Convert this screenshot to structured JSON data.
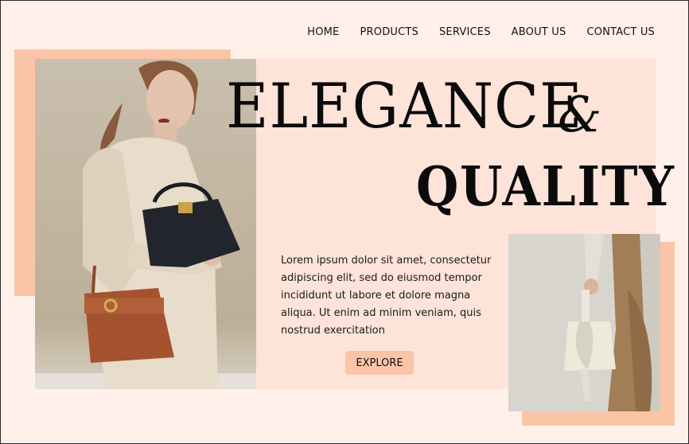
{
  "nav": {
    "items": [
      "HOME",
      "PRODUCTS",
      "SERVICES",
      "ABOUT US",
      "CONTACT US"
    ]
  },
  "hero": {
    "title_line1": "ELEGANCE",
    "ampersand": "&",
    "title_line2": "QUALITY",
    "body": "Lorem ipsum dolor sit amet, consectetur adipiscing elit, sed do eiusmod tempor incididunt ut labore et dolore magna aliqua. Ut enim ad minim veniam, quis nostrud exercitation",
    "cta_label": "EXPLORE"
  },
  "colors": {
    "background": "#fff1ea",
    "panel": "#fde3d8",
    "accent": "#fcc4a6",
    "text": "#0b0b0b"
  }
}
